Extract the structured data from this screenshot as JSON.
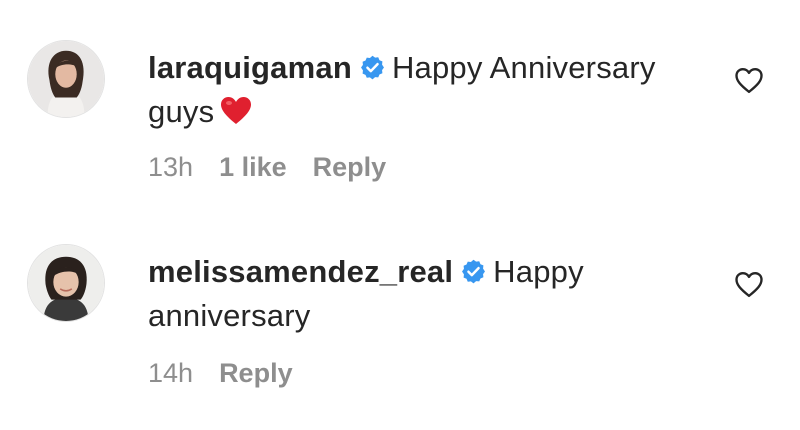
{
  "comments": [
    {
      "username": "laraquigaman",
      "text_line1": "Happy Anniversary",
      "text_line2": "guys",
      "emoji": "red-heart-emoji",
      "time": "13h",
      "likes": "1 like",
      "reply_label": "Reply",
      "verified": true
    },
    {
      "username": "melissamendez_real",
      "text_line1": "Happy",
      "text_line2": "anniversary",
      "time": "14h",
      "reply_label": "Reply",
      "verified": true
    }
  ],
  "colors": {
    "verified_blue": "#3897f0",
    "text": "#262626",
    "meta": "#8e8e8e",
    "heart_red": "#e0202f"
  },
  "icons": [
    "verified-badge-icon",
    "heart-outline-icon",
    "red-heart-emoji"
  ]
}
